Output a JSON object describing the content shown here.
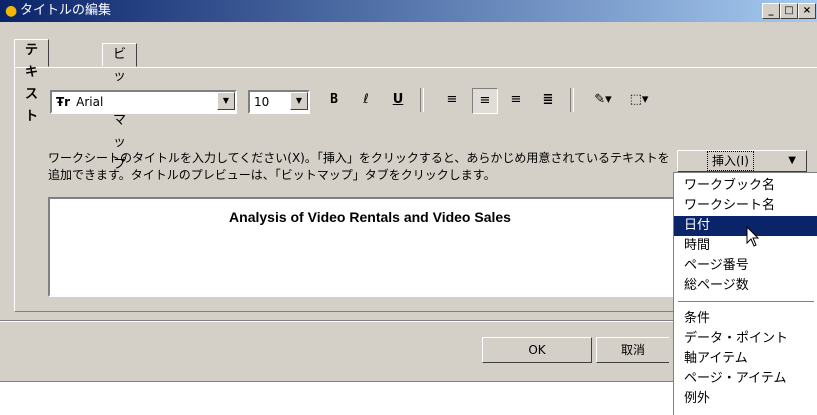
{
  "window": {
    "title": "タイトルの編集",
    "controls": {
      "minimize": "_",
      "maximize": "□",
      "close": "×"
    }
  },
  "tabs": [
    {
      "label": "テキスト",
      "active": true
    },
    {
      "label": "ビットマップ",
      "active": false
    }
  ],
  "toolbar": {
    "font_name": "Arial",
    "font_glyph": "Ŧr",
    "font_size": "10",
    "bold": "B",
    "italic": "ℓ",
    "underline": "U",
    "align_icons": [
      "align-left-icon",
      "align-center-icon",
      "align-right-icon",
      "align-justify-icon"
    ],
    "tool_icons": [
      "text-color-icon",
      "fill-color-icon"
    ]
  },
  "instructions": "ワークシートのタイトルを入力してください(X)。「挿入」をクリックすると、あらかじめ用意されているテキストを追加できます。タイトルのプレビューは、「ビットマップ」タブをクリックします。",
  "title_text": "Analysis of Video Rentals and Video Sales",
  "insert_button": {
    "label": "挿入(I)"
  },
  "insert_menu": {
    "group1": [
      "ワークブック名",
      "ワークシート名",
      "日付",
      "時間",
      "ページ番号",
      "総ページ数"
    ],
    "group2": [
      "条件",
      "データ・ポイント",
      "軸アイテム",
      "ページ・アイテム",
      "例外"
    ],
    "selected": "日付"
  },
  "buttons": {
    "ok": "OK",
    "cancel": "取消"
  },
  "colors": {
    "titlebar_start": "#0a246a",
    "titlebar_end": "#a6caf0",
    "dialog_bg": "#d4d0c8",
    "menu_highlight": "#0a246a"
  }
}
